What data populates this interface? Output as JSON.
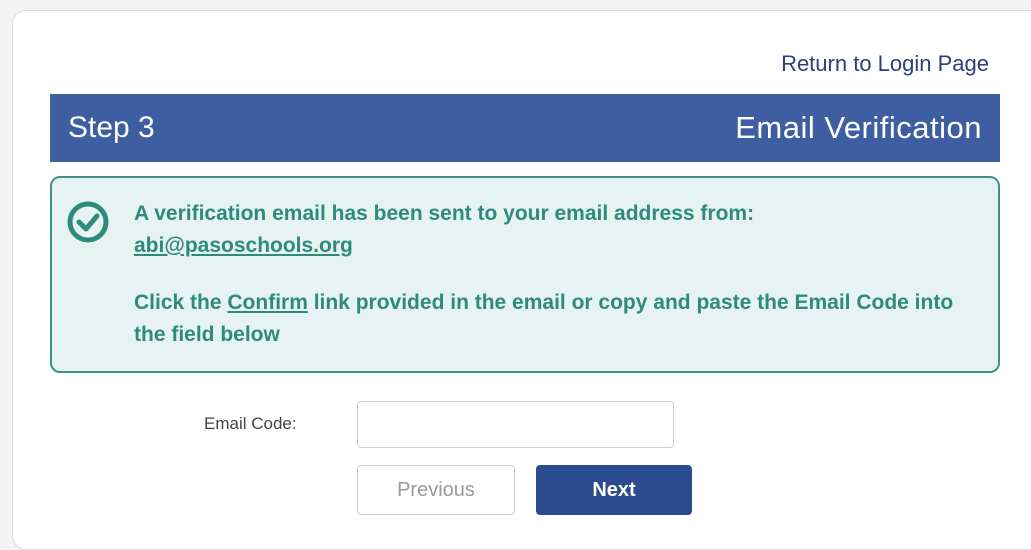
{
  "links": {
    "return_login": "Return to Login Page"
  },
  "header": {
    "step": "Step 3",
    "title": "Email Verification"
  },
  "notice": {
    "line1": "A verification email has been sent to your email address from:",
    "email": "abi@pasoschools.org",
    "line2_before": "Click the ",
    "line2_link": "Confirm",
    "line2_after": " link provided in the email or copy and paste the Email Code into the field below"
  },
  "form": {
    "email_code_label": "Email Code:",
    "email_code_value": "",
    "previous_label": "Previous",
    "next_label": "Next"
  },
  "colors": {
    "header_bg": "#3f5ea1",
    "notice_text": "#2e8a7c",
    "notice_bg": "#e7f3f2",
    "next_button": "#2b4c8f"
  },
  "icons": {
    "notice": "check-circle-icon"
  }
}
